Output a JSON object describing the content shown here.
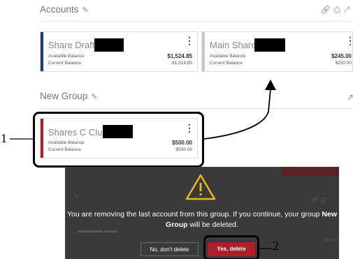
{
  "accounts_section": {
    "title": "Accounts",
    "edit_icon": "pencil-icon",
    "link_icon": "link-icon",
    "print_icon": "printer-icon"
  },
  "accounts": [
    {
      "name": "Share Draft",
      "available_label": "Available Balance",
      "available_value": "$1,524.85",
      "current_label": "Current Balance",
      "current_value": "$1,524.85",
      "color": "#1b3f73"
    },
    {
      "name": "Main Share",
      "available_label": "Available Balance",
      "available_value": "$245.00",
      "current_label": "Current Balance",
      "current_value": "$250.00",
      "color": "#c8c8c8"
    }
  ],
  "new_group": {
    "title": "New Group",
    "edit_icon": "pencil-icon",
    "account": {
      "name": "Shares C Club",
      "available_label": "Available Balance",
      "available_value": "$500.00",
      "current_label": "Current Balance",
      "current_value": "$500.00",
      "color": "#b01e2c"
    }
  },
  "callouts": {
    "first": "1",
    "second": "2"
  },
  "modal": {
    "icon": "warning-icon",
    "message_part1": "You are removing the last account from this group. If you continue, your group ",
    "group_name": "New Group",
    "message_part2": " will be deleted.",
    "cancel_label": "No, don't delete",
    "confirm_label": "Yes, delete"
  }
}
